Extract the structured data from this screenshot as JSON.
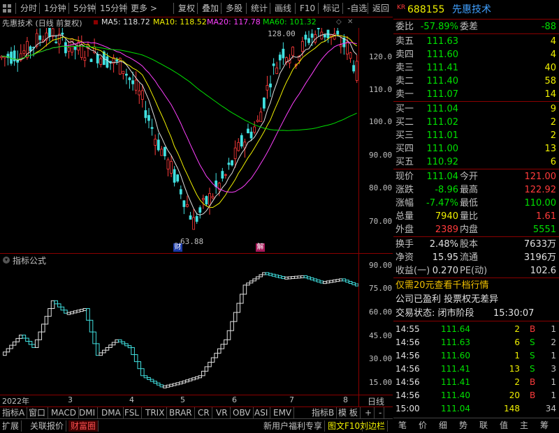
{
  "toolbar": {
    "period_items": [
      "分时",
      "1分钟",
      "5分钟",
      "15分钟",
      "更多 >"
    ],
    "action_items": [
      "复权",
      "叠加",
      "多股",
      "统计",
      "画线",
      "F10",
      "标记",
      "-自选",
      "返回"
    ]
  },
  "main_chart": {
    "title": "先惠技术 (日线 前复权)",
    "ma5": "MA5: 118.72",
    "ma10": "MA10: 118.52",
    "ma20": "MA20: 117.78",
    "ma60": "MA60: 101.32",
    "high_label": "128.00",
    "low_label": "63.88",
    "marker_cai": "财",
    "marker_jie": "解",
    "y_ticks": [
      "120.0",
      "110.0",
      "100.0",
      "90.00",
      "80.00",
      "70.00"
    ],
    "colors": {
      "ma5": "#e0e0e0",
      "ma10": "#f0f000",
      "ma20": "#ff40ff",
      "ma60": "#00e000",
      "up": "#ff3b3b",
      "down": "#40e0e0"
    }
  },
  "indicator_chart": {
    "title": "指标公式",
    "y_ticks": [
      "90.00",
      "75.00",
      "60.00",
      "45.00",
      "30.00",
      "15.00"
    ]
  },
  "x_axis": {
    "labels": [
      "2022年",
      "3",
      "4",
      "5",
      "6",
      "7",
      "8"
    ],
    "period": "日线"
  },
  "indicator_tabs": [
    "指标A",
    "窗口",
    "MACD",
    "DMI",
    "DMA",
    "FSL",
    "TRIX",
    "BRAR",
    "CR",
    "VR",
    "OBV",
    "ASI",
    "EMV",
    "指标B",
    "模 板",
    "+",
    "-"
  ],
  "bottom_bar": {
    "left_items": [
      "扩展",
      "关联报价",
      "财富圈"
    ],
    "right_items": [
      "新用户福利专享",
      "图文F10",
      "刘边栏"
    ]
  },
  "panel": {
    "kr_badge": "KR",
    "code": "688155",
    "name": "先惠技术",
    "weibi_label": "委比",
    "weibi_value": "-57.89%",
    "weicha_label": "委差",
    "weicha_value": "-88",
    "asks": [
      {
        "label": "卖五",
        "price": "111.63",
        "vol": "4"
      },
      {
        "label": "卖四",
        "price": "111.60",
        "vol": "4"
      },
      {
        "label": "卖三",
        "price": "111.41",
        "vol": "40"
      },
      {
        "label": "卖二",
        "price": "111.40",
        "vol": "58"
      },
      {
        "label": "卖一",
        "price": "111.07",
        "vol": "14"
      }
    ],
    "bids": [
      {
        "label": "买一",
        "price": "111.04",
        "vol": "9"
      },
      {
        "label": "买二",
        "price": "111.02",
        "vol": "2"
      },
      {
        "label": "买三",
        "price": "111.01",
        "vol": "2"
      },
      {
        "label": "买四",
        "price": "111.00",
        "vol": "13"
      },
      {
        "label": "买五",
        "price": "110.92",
        "vol": "6"
      }
    ],
    "quote": [
      {
        "l1": "现价",
        "v1": "111.04",
        "l2": "今开",
        "v2": "121.00",
        "c1": "g",
        "c2": "r"
      },
      {
        "l1": "涨跌",
        "v1": "-8.96",
        "l2": "最高",
        "v2": "122.92",
        "c1": "g",
        "c2": "r"
      },
      {
        "l1": "涨幅",
        "v1": "-7.47%",
        "l2": "最低",
        "v2": "110.00",
        "c1": "g",
        "c2": "g"
      },
      {
        "l1": "总量",
        "v1": "7940",
        "l2": "量比",
        "v2": "1.61",
        "c1": "y",
        "c2": "r"
      },
      {
        "l1": "外盘",
        "v1": "2389",
        "l2": "内盘",
        "v2": "5551",
        "c1": "r",
        "c2": "g"
      }
    ],
    "stats": [
      {
        "l1": "换手",
        "v1": "2.48%",
        "l2": "股本",
        "v2": "7633万"
      },
      {
        "l1": "净资",
        "v1": "15.95",
        "l2": "流通",
        "v2": "3196万"
      },
      {
        "l1": "收益(一)",
        "v1": "0.270",
        "l2": "PE(动)",
        "v2": "102.6"
      }
    ],
    "promo": "仅需20元查看千档行情",
    "notice": "公司已盈利 投票权无差异",
    "status_label": "交易状态: 闭市阶段",
    "status_time": "15:30:07",
    "ticks": [
      {
        "time": "14:55",
        "price": "111.64",
        "vol": "2",
        "bs": "B",
        "cnt": "1"
      },
      {
        "time": "14:56",
        "price": "111.63",
        "vol": "6",
        "bs": "S",
        "cnt": "2"
      },
      {
        "time": "14:56",
        "price": "111.60",
        "vol": "1",
        "bs": "S",
        "cnt": "1"
      },
      {
        "time": "14:56",
        "price": "111.41",
        "vol": "13",
        "bs": "S",
        "cnt": "3"
      },
      {
        "time": "14:56",
        "price": "111.41",
        "vol": "2",
        "bs": "B",
        "cnt": "1"
      },
      {
        "time": "14:56",
        "price": "111.40",
        "vol": "20",
        "bs": "B",
        "cnt": "1"
      },
      {
        "time": "15:00",
        "price": "111.04",
        "vol": "148",
        "bs": "",
        "cnt": "34"
      }
    ],
    "bottom_tabs": [
      "笔",
      "价",
      "细",
      "势",
      "联",
      "值",
      "主",
      "筹"
    ]
  }
}
